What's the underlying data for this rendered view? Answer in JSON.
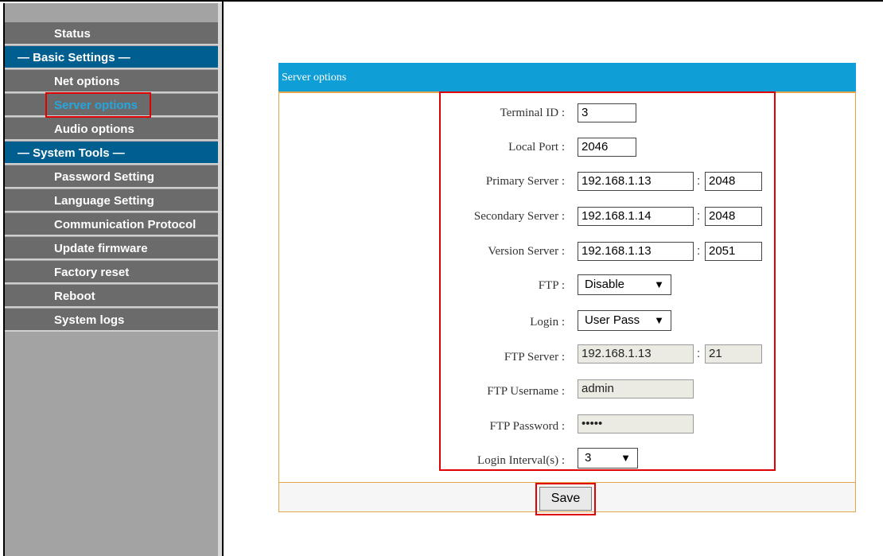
{
  "sidebar": {
    "items": [
      {
        "label": "Status",
        "type": "item"
      },
      {
        "label": "— Basic Settings —",
        "type": "section"
      },
      {
        "label": "Net options",
        "type": "item"
      },
      {
        "label": "Server options",
        "type": "item",
        "active": true
      },
      {
        "label": "Audio options",
        "type": "item"
      },
      {
        "label": "— System Tools —",
        "type": "section"
      },
      {
        "label": "Password Setting",
        "type": "item"
      },
      {
        "label": "Language Setting",
        "type": "item"
      },
      {
        "label": "Communication Protocol",
        "type": "item"
      },
      {
        "label": "Update firmware",
        "type": "item"
      },
      {
        "label": "Factory reset",
        "type": "item"
      },
      {
        "label": "Reboot",
        "type": "item"
      },
      {
        "label": "System logs",
        "type": "item"
      }
    ]
  },
  "panel": {
    "title": "Server options",
    "fields": {
      "terminal_id": {
        "label": "Terminal ID :",
        "value": "3"
      },
      "local_port": {
        "label": "Local Port :",
        "value": "2046"
      },
      "primary_server": {
        "label": "Primary Server :",
        "host": "192.168.1.13",
        "port": "2048"
      },
      "secondary_server": {
        "label": "Secondary Server :",
        "host": "192.168.1.14",
        "port": "2048"
      },
      "version_server": {
        "label": "Version Server :",
        "host": "192.168.1.13",
        "port": "2051"
      },
      "ftp": {
        "label": "FTP :",
        "value": "Disable"
      },
      "login": {
        "label": "Login :",
        "value": "User Pass"
      },
      "ftp_server": {
        "label": "FTP Server :",
        "host": "192.168.1.13",
        "port": "21"
      },
      "ftp_username": {
        "label": "FTP Username :",
        "value": "admin"
      },
      "ftp_password": {
        "label": "FTP Password :",
        "value": "•••••"
      },
      "login_interval": {
        "label": "Login Interval(s) :",
        "value": "3"
      }
    },
    "colon": ":",
    "save_label": "Save"
  },
  "colors": {
    "section_bg": "#005f8f",
    "item_bg": "#6b6b6b",
    "active_text": "#22a7e0",
    "panel_header": "#0f9fd6",
    "panel_border": "#e5a54a",
    "highlight": "#e00000"
  }
}
